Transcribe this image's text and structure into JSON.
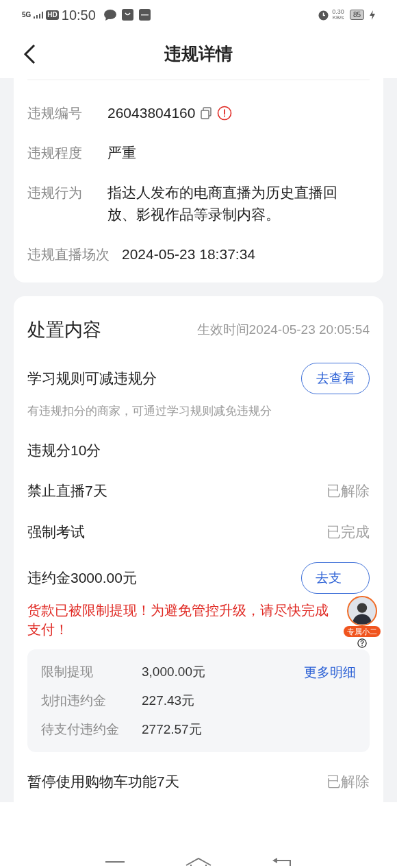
{
  "status_bar": {
    "network": "5G",
    "hd": "HD",
    "time": "10:50",
    "speed": "0.30",
    "speed_unit": "KB/s",
    "battery": "85"
  },
  "header": {
    "title": "违规详情"
  },
  "violation": {
    "rows": [
      {
        "label": "违规编号",
        "value": "26043804160",
        "kind": "id"
      },
      {
        "label": "违规程度",
        "value": "严重",
        "kind": "text"
      },
      {
        "label": "违规行为",
        "value": "指达人发布的电商直播为历史直播回放、影视作品等录制内容。",
        "kind": "text"
      },
      {
        "label": "违规直播场次",
        "value": "2024-05-23 18:37:34",
        "kind": "text"
      }
    ]
  },
  "disposal": {
    "title": "处置内容",
    "effective_time": "生效时间2024-05-23 20:05:54",
    "items": [
      {
        "kind": "action",
        "label": "学习规则可减违规分",
        "button": "去查看",
        "note": "有违规扣分的商家，可通过学习规则减免违规分"
      },
      {
        "kind": "plain",
        "label": "违规分10分"
      },
      {
        "kind": "status",
        "label": "禁止直播7天",
        "status": "已解除"
      },
      {
        "kind": "status",
        "label": "强制考试",
        "status": "已完成"
      },
      {
        "kind": "payment",
        "label": "违约金3000.00元",
        "button": "去支",
        "warning": "货款已被限制提现！为避免管控升级，请尽快完成支付！",
        "details": {
          "link": "更多明细",
          "rows": [
            {
              "label": "限制提现",
              "value": "3,000.00元"
            },
            {
              "label": "划扣违约金",
              "value": "227.43元"
            },
            {
              "label": "待支付违约金",
              "value": "2772.57元"
            }
          ]
        }
      },
      {
        "kind": "status",
        "label": "暂停使用购物车功能7天",
        "status": "已解除"
      }
    ]
  },
  "assistant": {
    "badge": "专属小二"
  }
}
